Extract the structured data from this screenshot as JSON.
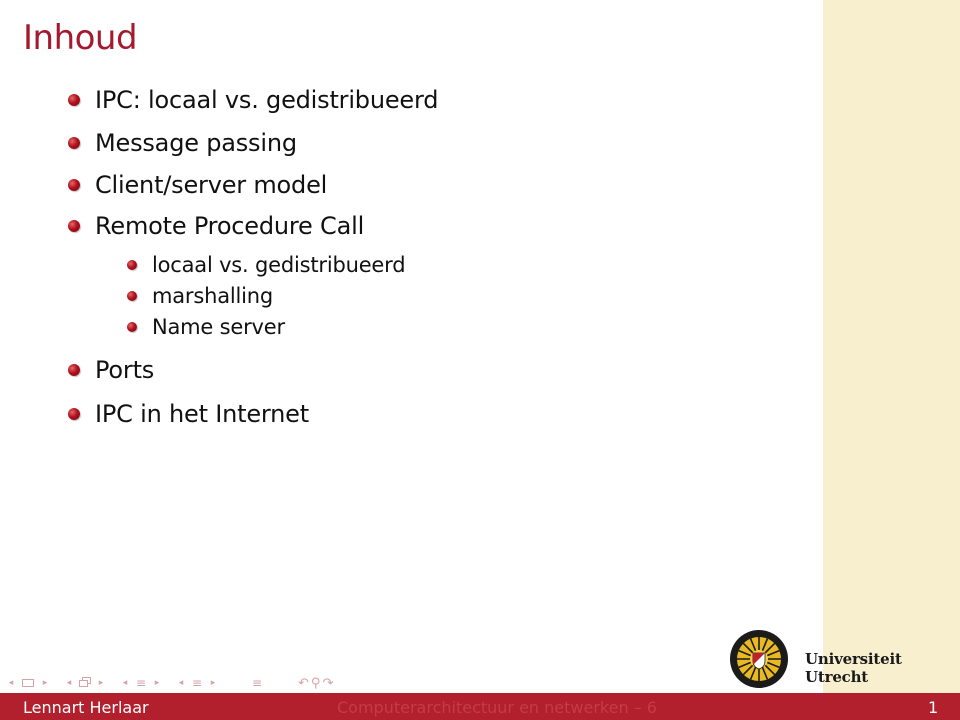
{
  "slide": {
    "title": "Inhoud",
    "items": [
      {
        "label": "IPC: locaal vs. gedistribueerd"
      },
      {
        "label": "Message passing"
      },
      {
        "label": "Client/server model"
      },
      {
        "label": "Remote Procedure Call",
        "subitems": [
          {
            "label": "locaal vs. gedistribueerd"
          },
          {
            "label": "marshalling"
          },
          {
            "label": "Name server"
          }
        ]
      },
      {
        "label": "Ports"
      },
      {
        "label": "IPC in het Internet"
      }
    ]
  },
  "navigation": {
    "icons": [
      "prev-arrow-icon",
      "frame-icon",
      "next-arrow-icon",
      "subsection-icon",
      "section-icon",
      "lines-icon",
      "undo-icon",
      "search-icon",
      "redo-icon"
    ],
    "undo_glyph": "↶",
    "search_glyph": "⚲",
    "redo_glyph": "↷",
    "left_arrow": "◂",
    "right_arrow": "▸",
    "lines_glyph": "≡"
  },
  "branding": {
    "university": "Universiteit Utrecht"
  },
  "footer": {
    "author": "Lennart Herlaar",
    "course": "Computerarchitectuur en netwerken – 6",
    "page": "1"
  },
  "colors": {
    "accent": "#a5192f",
    "footer_bg": "#b21f2d",
    "sidebar_bg": "#f8efcf"
  }
}
